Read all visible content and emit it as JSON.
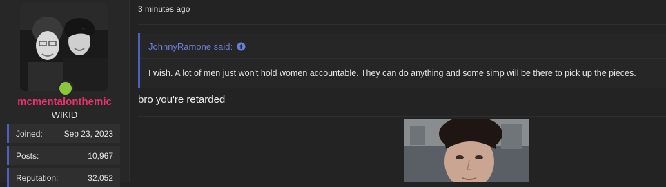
{
  "user": {
    "username": "mcmentalonthemic",
    "title": "WIKID",
    "stats": [
      {
        "label": "Joined:",
        "value": "Sep 23, 2023"
      },
      {
        "label": "Posts:",
        "value": "10,967"
      },
      {
        "label": "Reputation:",
        "value": "32,052"
      }
    ],
    "online_color": "#8cc63f",
    "name_color": "#e8336d"
  },
  "post": {
    "timestamp": "3 minutes ago",
    "quote": {
      "author": "JohnnyRamone said:",
      "text": "I wish. A lot of men just won't hold women accountable. They can do anything and some simp will be there to pick up the pieces."
    },
    "body": "bro you're retarded"
  },
  "colors": {
    "accent": "#4f5fbf",
    "quote_link": "#6c7fd6",
    "background": "#232323"
  }
}
